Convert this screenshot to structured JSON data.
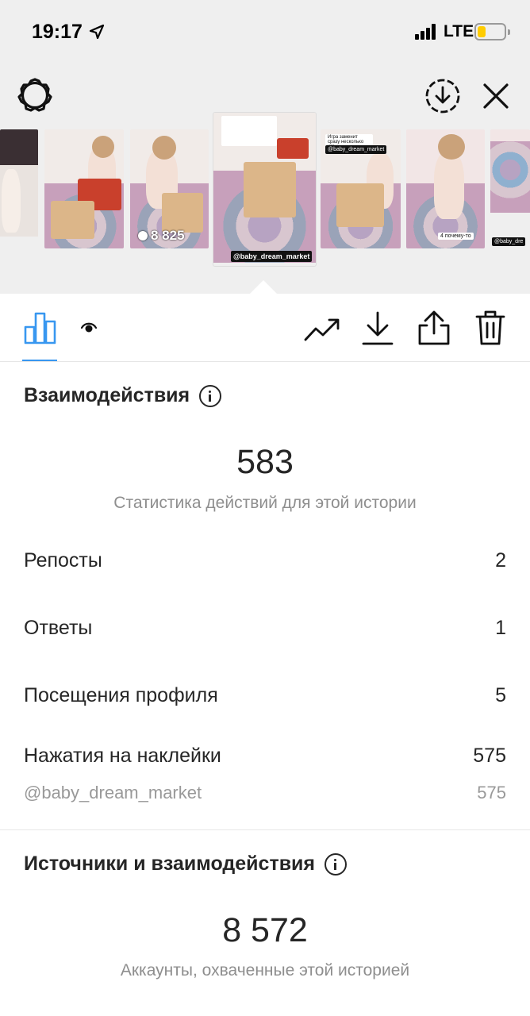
{
  "status_bar": {
    "time": "19:17",
    "network": "LTE",
    "battery_level": 0.3,
    "battery_color": "#ffcc00"
  },
  "toolbar": {
    "left_icon": "gear-icon",
    "right_icons": [
      "download-circle-icon",
      "close-icon"
    ]
  },
  "thumbnails": {
    "views_count": "8 825",
    "mention_label": "@baby_dream_market",
    "thumb_captions": [
      "Игра заменит сразу несколько игр",
      "@baby_dream_market",
      "4 почему-то",
      "@baby_dre"
    ]
  },
  "tabs": {
    "active": "stats",
    "items": [
      "bar-chart-icon",
      "eye-icon"
    ],
    "actions": [
      "trend-icon",
      "download-icon",
      "share-icon",
      "trash-icon"
    ],
    "accent_color": "#3897f0"
  },
  "interactions": {
    "title": "Взаимодействия",
    "total": "583",
    "caption": "Статистика действий для этой истории",
    "rows": [
      {
        "label": "Репосты",
        "value": "2"
      },
      {
        "label": "Ответы",
        "value": "1"
      },
      {
        "label": "Посещения профиля",
        "value": "5"
      },
      {
        "label": "Нажатия на наклейки",
        "value": "575"
      }
    ],
    "sub_row": {
      "label": "@baby_dream_market",
      "value": "575"
    }
  },
  "discovery": {
    "title": "Источники и взаимодействия",
    "total": "8 572",
    "caption": "Аккаунты, охваченные этой историей"
  }
}
